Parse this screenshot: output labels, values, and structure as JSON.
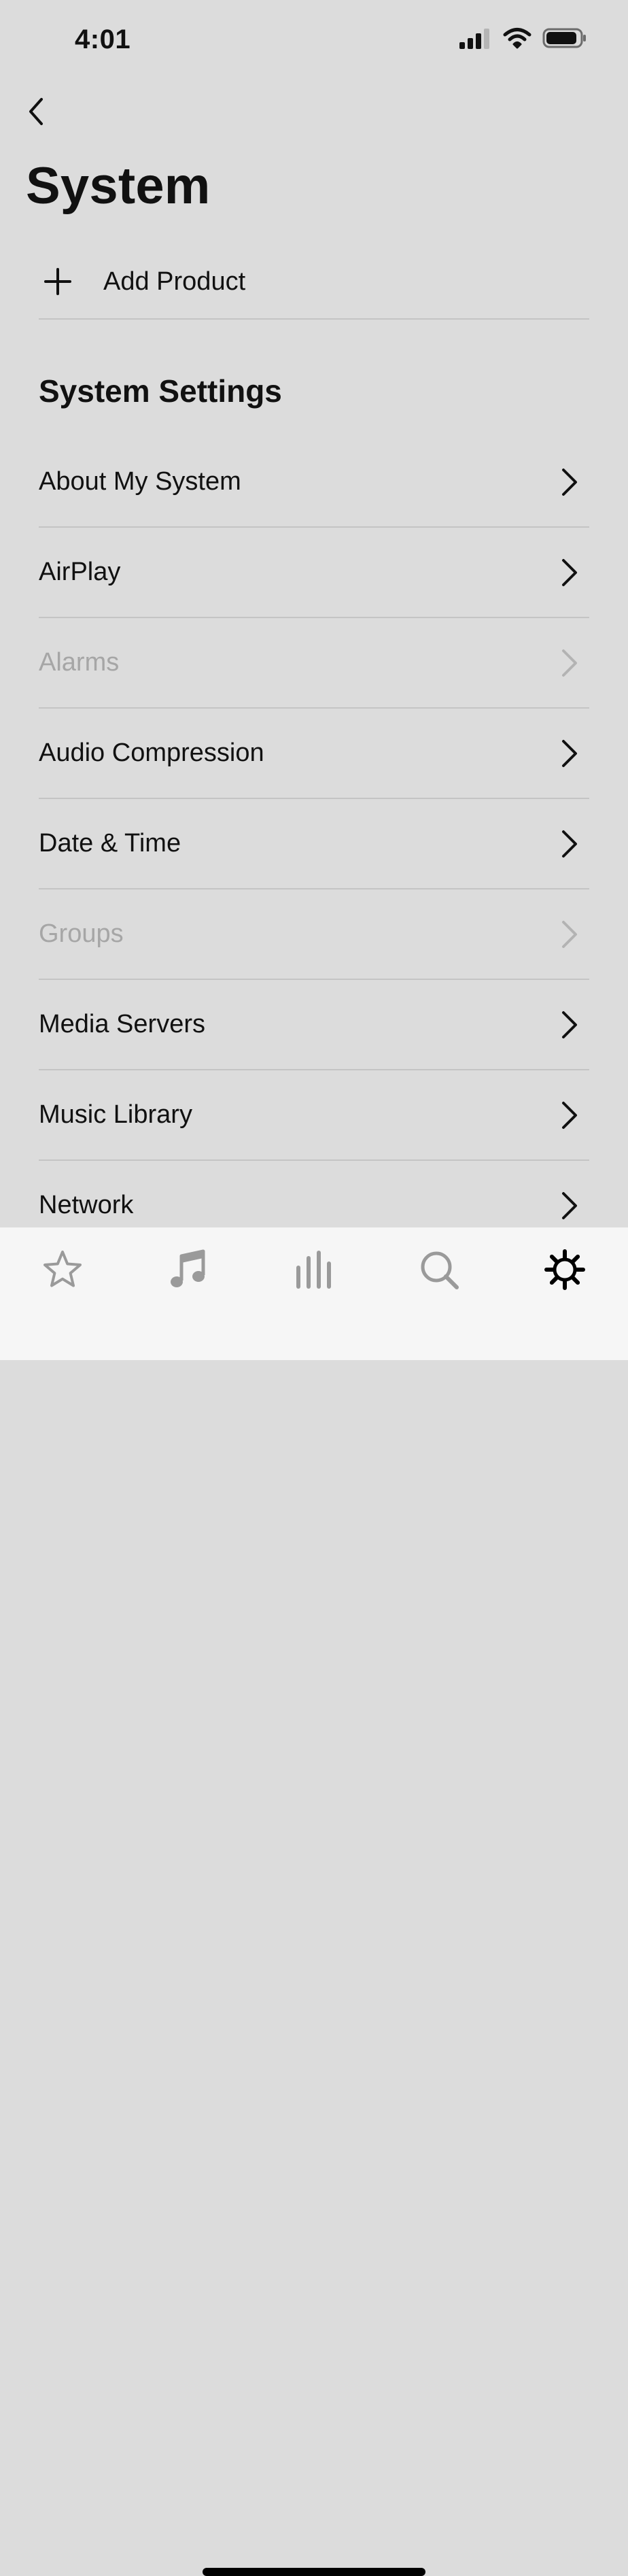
{
  "status_bar": {
    "time": "4:01"
  },
  "header": {
    "title": "System"
  },
  "add_product": {
    "label": "Add Product"
  },
  "system_settings": {
    "title": "System Settings",
    "items": [
      {
        "label": "About My System",
        "enabled": true
      },
      {
        "label": "AirPlay",
        "enabled": true
      },
      {
        "label": "Alarms",
        "enabled": false
      },
      {
        "label": "Audio Compression",
        "enabled": true
      },
      {
        "label": "Date & Time",
        "enabled": true
      },
      {
        "label": "Groups",
        "enabled": false
      },
      {
        "label": "Media Servers",
        "enabled": true
      },
      {
        "label": "Music Library",
        "enabled": true
      },
      {
        "label": "Network",
        "enabled": true
      }
    ]
  },
  "tab_bar": {
    "tabs": [
      {
        "icon": "star-icon",
        "active": false
      },
      {
        "icon": "music-note-icon",
        "active": false
      },
      {
        "icon": "rooms-bars-icon",
        "active": false
      },
      {
        "icon": "search-icon",
        "active": false
      },
      {
        "icon": "gear-icon",
        "active": true
      }
    ]
  },
  "colors": {
    "background": "#dcdcdc",
    "disabled_text": "#a6a6a6",
    "tab_bar": "#f6f6f6",
    "tab_inactive": "#9a9a9a"
  }
}
